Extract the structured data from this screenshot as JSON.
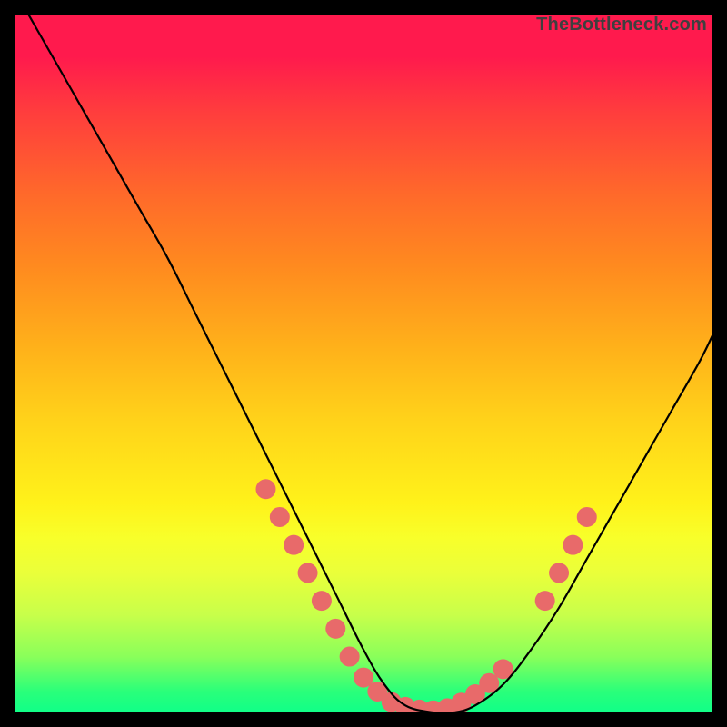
{
  "watermark": "TheBottleneck.com",
  "chart_data": {
    "type": "line",
    "title": "",
    "xlabel": "",
    "ylabel": "",
    "xlim": [
      0,
      100
    ],
    "ylim": [
      0,
      100
    ],
    "grid": false,
    "legend": false,
    "background_gradient": {
      "top": "#ff1a4d",
      "bottom": "#10ff88"
    },
    "series": [
      {
        "name": "bottleneck-curve",
        "color": "#000000",
        "x": [
          2,
          6,
          10,
          14,
          18,
          22,
          26,
          30,
          34,
          38,
          42,
          46,
          50,
          53,
          56,
          60,
          63,
          66,
          70,
          74,
          78,
          82,
          86,
          90,
          94,
          98,
          100
        ],
        "y": [
          100,
          93,
          86,
          79,
          72,
          65,
          57,
          49,
          41,
          33,
          25,
          17,
          9,
          4,
          1,
          0,
          0,
          1,
          4,
          9,
          15,
          22,
          29,
          36,
          43,
          50,
          54
        ]
      }
    ],
    "markers": [
      {
        "name": "highlight-dots",
        "color": "#e86a6a",
        "radius": 11,
        "points": [
          {
            "x": 36,
            "y": 32
          },
          {
            "x": 38,
            "y": 28
          },
          {
            "x": 40,
            "y": 24
          },
          {
            "x": 42,
            "y": 20
          },
          {
            "x": 44,
            "y": 16
          },
          {
            "x": 46,
            "y": 12
          },
          {
            "x": 48,
            "y": 8
          },
          {
            "x": 50,
            "y": 5
          },
          {
            "x": 52,
            "y": 3
          },
          {
            "x": 54,
            "y": 1.5
          },
          {
            "x": 56,
            "y": 0.8
          },
          {
            "x": 58,
            "y": 0.4
          },
          {
            "x": 60,
            "y": 0.3
          },
          {
            "x": 62,
            "y": 0.6
          },
          {
            "x": 64,
            "y": 1.4
          },
          {
            "x": 66,
            "y": 2.6
          },
          {
            "x": 68,
            "y": 4.2
          },
          {
            "x": 70,
            "y": 6.2
          },
          {
            "x": 76,
            "y": 16
          },
          {
            "x": 78,
            "y": 20
          },
          {
            "x": 80,
            "y": 24
          },
          {
            "x": 82,
            "y": 28
          }
        ]
      }
    ]
  }
}
